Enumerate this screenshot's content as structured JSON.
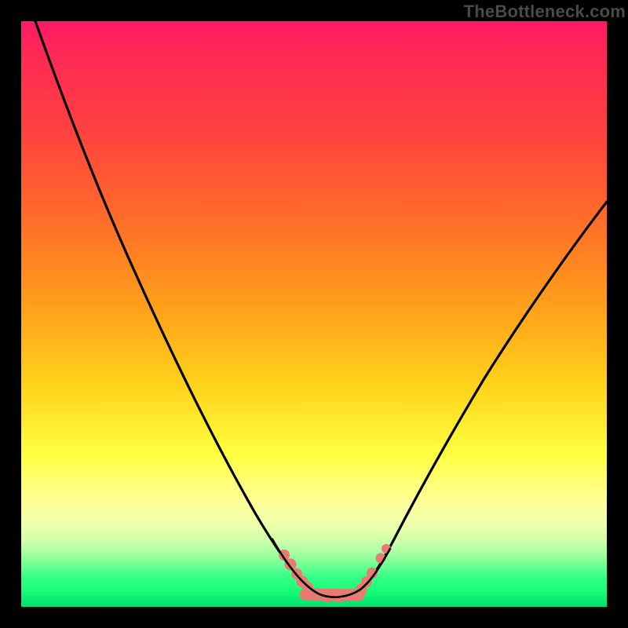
{
  "watermark": {
    "text": "TheBottleneck.com"
  },
  "chart_data": {
    "type": "line",
    "title": "",
    "xlabel": "",
    "ylabel": "",
    "xlim": [
      0,
      100
    ],
    "ylim": [
      0,
      100
    ],
    "grid": false,
    "legend": false,
    "series": [
      {
        "name": "curve",
        "color": "#000000",
        "x": [
          2,
          10,
          20,
          30,
          40,
          46,
          48,
          50,
          55,
          58,
          60,
          65,
          70,
          80,
          90,
          100
        ],
        "y": [
          100,
          82,
          60,
          40,
          20,
          6,
          3,
          1,
          0,
          2,
          5,
          12,
          22,
          41,
          57,
          70
        ]
      },
      {
        "name": "accent-band",
        "color": "#e87a72",
        "x": [
          44,
          46,
          48,
          50,
          52,
          54,
          55,
          56,
          57,
          58,
          59,
          60,
          61
        ],
        "y": [
          8,
          5,
          2,
          1,
          0.5,
          0.5,
          0.5,
          1,
          2,
          3,
          4,
          6,
          8
        ]
      }
    ],
    "annotations": []
  },
  "colors": {
    "curve": "#000000",
    "accent": "#e87a72",
    "frame": "#000000"
  }
}
